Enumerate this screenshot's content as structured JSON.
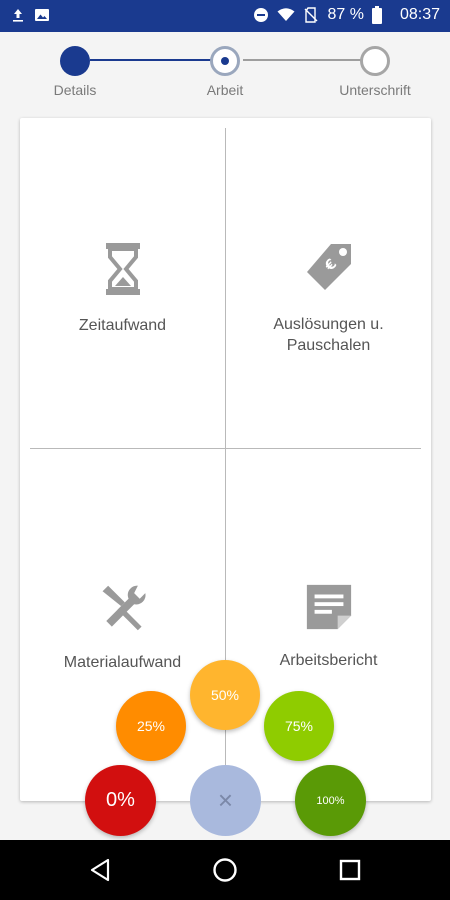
{
  "statusbar": {
    "battery_pct": "87 %",
    "time": "08:37",
    "left_icons": [
      "upload-icon",
      "image-icon"
    ],
    "right_icons": [
      "do-not-disturb-icon",
      "wifi-icon",
      "no-sim-icon",
      "battery-icon"
    ]
  },
  "stepper": {
    "steps": [
      {
        "label": "Details",
        "state": "completed"
      },
      {
        "label": "Arbeit",
        "state": "current"
      },
      {
        "label": "Unterschrift",
        "state": "pending"
      }
    ]
  },
  "tiles": [
    {
      "label": "Zeitaufwand",
      "icon": "hourglass-icon"
    },
    {
      "label": "Auslösungen u.\nPauschalen",
      "icon": "price-tag-icon"
    },
    {
      "label": "Materialaufwand",
      "icon": "tools-icon"
    },
    {
      "label": "Arbeitsbericht",
      "icon": "note-icon"
    }
  ],
  "progress_options": [
    {
      "label": "0%",
      "color": "#d20f0f"
    },
    {
      "label": "25%",
      "color": "#ff8c00"
    },
    {
      "label": "50%",
      "color": "#ffb52e"
    },
    {
      "label": "75%",
      "color": "#8fcc00"
    },
    {
      "label": "100%",
      "color": "#5a9a06"
    }
  ],
  "close_button": {
    "label": "×",
    "color": "#a9b9dd"
  },
  "colors": {
    "primary": "#1a3a8f",
    "icon_gray": "#9a9a9a"
  },
  "navbar": {
    "buttons": [
      "back-icon",
      "home-icon",
      "recents-icon"
    ]
  }
}
